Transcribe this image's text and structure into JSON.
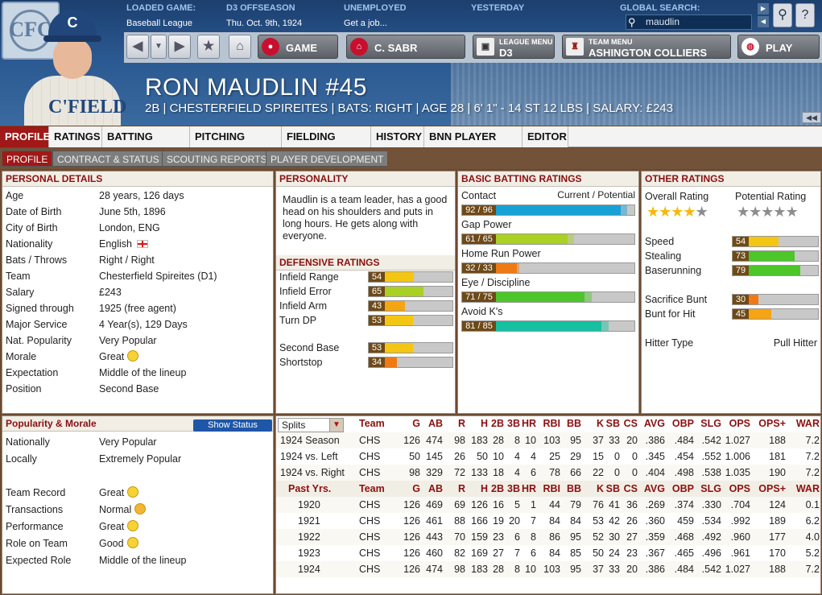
{
  "top": {
    "loaded_label": "LOADED GAME:",
    "loaded_value": "Baseball League",
    "season_label": "D3 OFFSEASON",
    "season_value": "Thu. Oct. 9th, 1924",
    "status_label": "UNEMPLOYED",
    "status_value": "Get a job...",
    "yesterday_label": "YESTERDAY",
    "search_label": "GLOBAL SEARCH:",
    "search_value": "maudlin"
  },
  "toolbar": {
    "back": "◀",
    "dropdown": "▼",
    "forward": "▶",
    "star": "★",
    "home": "⌂",
    "game": "GAME",
    "team": "C. SABR",
    "league_small": "LEAGUE MENU",
    "league_big": "D3",
    "teammenu_small": "TEAM MENU",
    "teammenu_big": "ASHINGTON COLLIERS",
    "play": "PLAY"
  },
  "player": {
    "name": "RON MAUDLIN  #45",
    "sub": "2B | CHESTERFIELD SPIREITES | BATS: RIGHT | AGE 28 | 6' 1\" - 14 ST 12 LBS | SALARY: £243",
    "logo_text": "CFC",
    "cap_letter": "C",
    "jersey_text": "C'FIELD"
  },
  "tabs": [
    "PROFILE",
    "RATINGS",
    "BATTING STATS",
    "PITCHING STATS",
    "FIELDING STATS",
    "HISTORY",
    "BNN PLAYER PAGE",
    "EDITOR"
  ],
  "subtabs": [
    "PROFILE",
    "CONTRACT & STATUS",
    "SCOUTING REPORTS",
    "PLAYER DEVELOPMENT"
  ],
  "personal": {
    "title": "PERSONAL DETAILS",
    "rows": [
      {
        "k": "Age",
        "v": "28 years, 126 days"
      },
      {
        "k": "Date of Birth",
        "v": "June 5th, 1896"
      },
      {
        "k": "City of Birth",
        "v": "London, ENG"
      },
      {
        "k": "Nationality",
        "v": "English"
      },
      {
        "k": "Bats / Throws",
        "v": "Right / Right"
      },
      {
        "k": "Team",
        "v": "Chesterfield Spireites (D1)"
      },
      {
        "k": "Salary",
        "v": "£243"
      },
      {
        "k": "Signed through",
        "v": "1925 (free agent)"
      },
      {
        "k": "Major Service",
        "v": "4 Year(s), 129 Days"
      },
      {
        "k": "Nat. Popularity",
        "v": "Very Popular"
      },
      {
        "k": "Morale",
        "v": "Great"
      },
      {
        "k": "Expectation",
        "v": "Middle of the lineup"
      },
      {
        "k": "Position",
        "v": "Second Base"
      }
    ]
  },
  "popularity": {
    "title": "Popularity & Morale",
    "button": "Show Status",
    "rows": [
      {
        "k": "Nationally",
        "v": "Very Popular"
      },
      {
        "k": "Locally",
        "v": "Extremely Popular"
      },
      {
        "k": "Team Record",
        "v": "Great"
      },
      {
        "k": "Transactions",
        "v": "Normal"
      },
      {
        "k": "Performance",
        "v": "Great"
      },
      {
        "k": "Role on Team",
        "v": "Good"
      },
      {
        "k": "Expected Role",
        "v": "Middle of the lineup"
      }
    ]
  },
  "personality": {
    "title": "PERSONALITY",
    "text": "Maudlin is a team leader, has a good head on his shoulders and puts in long hours. He gets along with everyone."
  },
  "defensive": {
    "title": "DEFENSIVE RATINGS",
    "rows": [
      {
        "k": "Infield Range",
        "v": 54,
        "color": "#f3c614"
      },
      {
        "k": "Infield Error",
        "v": 65,
        "color": "#a9d023"
      },
      {
        "k": "Infield Arm",
        "v": 43,
        "color": "#f5a413"
      },
      {
        "k": "Turn DP",
        "v": 53,
        "color": "#f3c614"
      },
      {
        "k": "Second Base",
        "v": 53,
        "color": "#f3c614"
      },
      {
        "k": "Shortstop",
        "v": 34,
        "color": "#ef7a14"
      }
    ]
  },
  "batting": {
    "title": "BASIC BATTING RATINGS",
    "header_right": "Current / Potential",
    "rows": [
      {
        "k": "Contact",
        "cur": 92,
        "pot": 96,
        "label": "92 / 96",
        "color": "#17a2d6"
      },
      {
        "k": "Gap Power",
        "cur": 61,
        "pot": 65,
        "label": "61 / 65",
        "color": "#a9d023"
      },
      {
        "k": "Home Run Power",
        "cur": 32,
        "pot": 33,
        "label": "32 / 33",
        "color": "#ef7a14"
      },
      {
        "k": "Eye / Discipline",
        "cur": 71,
        "pot": 75,
        "label": "71 / 75",
        "color": "#4cc629"
      },
      {
        "k": "Avoid K's",
        "cur": 81,
        "pot": 85,
        "label": "81 / 85",
        "color": "#16c0a0"
      }
    ]
  },
  "other": {
    "title": "OTHER RATINGS",
    "overall_label": "Overall Rating",
    "potential_label": "Potential Rating",
    "overall_stars": 4,
    "potential_stars": 4.5,
    "rows": [
      {
        "k": "Speed",
        "v": 54,
        "color": "#f3c614"
      },
      {
        "k": "Stealing",
        "v": 73,
        "color": "#4cc629"
      },
      {
        "k": "Baserunning",
        "v": 79,
        "color": "#4cc629"
      },
      {
        "k": "Sacrifice Bunt",
        "v": 30,
        "color": "#ef7a14"
      },
      {
        "k": "Bunt for Hit",
        "v": 45,
        "color": "#f5a413"
      }
    ],
    "hitter_label": "Hitter Type",
    "hitter_value": "Pull Hitter"
  },
  "stats": {
    "split_label": "Splits",
    "headers": [
      "Team",
      "G",
      "AB",
      "R",
      "H",
      "2B",
      "3B",
      "HR",
      "RBI",
      "BB",
      "K",
      "SB",
      "CS",
      "AVG",
      "OBP",
      "SLG",
      "OPS",
      "OPS+",
      "WAR"
    ],
    "past_label": "Past Yrs.",
    "split_rows": [
      [
        "1924 Season",
        "CHS",
        "126",
        "474",
        "98",
        "183",
        "28",
        "8",
        "10",
        "103",
        "95",
        "37",
        "33",
        "20",
        ".386",
        ".484",
        ".542",
        "1.027",
        "188",
        "7.2"
      ],
      [
        "1924 vs. Left",
        "CHS",
        "50",
        "145",
        "26",
        "50",
        "10",
        "4",
        "4",
        "25",
        "29",
        "15",
        "0",
        "0",
        ".345",
        ".454",
        ".552",
        "1.006",
        "181",
        "7.2"
      ],
      [
        "1924 vs. Right",
        "CHS",
        "98",
        "329",
        "72",
        "133",
        "18",
        "4",
        "6",
        "78",
        "66",
        "22",
        "0",
        "0",
        ".404",
        ".498",
        ".538",
        "1.035",
        "190",
        "7.2"
      ]
    ],
    "past_rows": [
      [
        "1920",
        "CHS",
        "126",
        "469",
        "69",
        "126",
        "16",
        "5",
        "1",
        "44",
        "79",
        "76",
        "41",
        "36",
        ".269",
        ".374",
        ".330",
        ".704",
        "124",
        "0.1"
      ],
      [
        "1921",
        "CHS",
        "126",
        "461",
        "88",
        "166",
        "19",
        "20",
        "7",
        "84",
        "84",
        "53",
        "42",
        "26",
        ".360",
        "459",
        ".534",
        ".992",
        "189",
        "6.2"
      ],
      [
        "1922",
        "CHS",
        "126",
        "443",
        "70",
        "159",
        "23",
        "6",
        "8",
        "86",
        "95",
        "52",
        "30",
        "27",
        ".359",
        ".468",
        ".492",
        ".960",
        "177",
        "4.0"
      ],
      [
        "1923",
        "CHS",
        "126",
        "460",
        "82",
        "169",
        "27",
        "7",
        "6",
        "84",
        "85",
        "50",
        "24",
        "23",
        ".367",
        ".465",
        ".496",
        ".961",
        "170",
        "5.2"
      ],
      [
        "1924",
        "CHS",
        "126",
        "474",
        "98",
        "183",
        "28",
        "8",
        "10",
        "103",
        "95",
        "37",
        "33",
        "20",
        ".386",
        ".484",
        ".542",
        "1.027",
        "188",
        "7.2"
      ]
    ]
  }
}
